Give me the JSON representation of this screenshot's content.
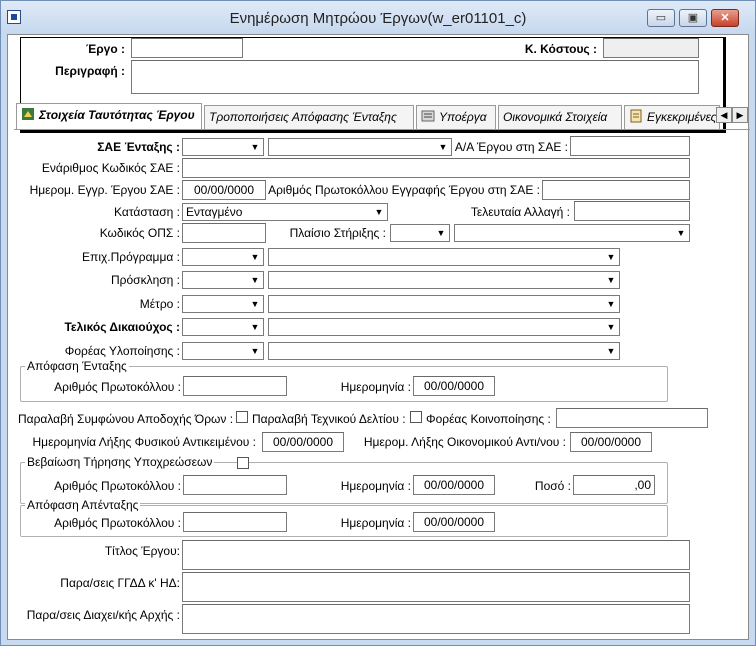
{
  "window": {
    "title": "Ενημέρωση Μητρώου Έργων(w_er01101_c)",
    "minimize_label": "▭",
    "maximize_label": "▣",
    "close_label": "✕"
  },
  "header": {
    "project_label": "Έργο :",
    "project_value": "",
    "cost_code_label": "Κ. Κόστους :",
    "cost_code_value": "",
    "description_label": "Περιγραφή :",
    "description_value": ""
  },
  "tabs": [
    {
      "label": "Στοιχεία Ταυτότητας Έργου",
      "icon": "identity-icon",
      "active": true
    },
    {
      "label": "Τροποποιήσεις Απόφασης Ένταξης",
      "icon": "",
      "active": false
    },
    {
      "label": "Υποέργα",
      "icon": "subprojects-icon",
      "active": false
    },
    {
      "label": "Οικονομικά Στοιχεία",
      "icon": "",
      "active": false
    },
    {
      "label": "Εγκεκριμένες Π",
      "icon": "approved-icon",
      "active": false
    }
  ],
  "tab_scroll": {
    "left": "◀",
    "right": "▶"
  },
  "form": {
    "sae_label": "ΣΑΕ Ένταξης :",
    "sae_code": "",
    "sae_desc": "",
    "aa_label": "Α/Α Έργου στη ΣΑΕ :",
    "aa_value": "",
    "enarithmos_label": "Ενάριθμος Κωδικός ΣΑΕ :",
    "enarithmos_value": "",
    "reg_date_label": "Ημερομ. Εγγρ. Έργου ΣΑΕ :",
    "reg_date_value": "00/00/0000",
    "protocol_reg_label": "Αριθμός Πρωτοκόλλου Εγγραφής Έργου στη ΣΑΕ :",
    "protocol_reg_value": "",
    "status_label": "Κατάσταση :",
    "status_value": "Ενταγμένο",
    "last_change_label": "Τελευταία Αλλαγή :",
    "last_change_value": "",
    "ops_label": "Κωδικός ΟΠΣ :",
    "ops_value": "",
    "support_label": "Πλαίσιο Στήριξης :",
    "support_code": "",
    "support_desc": "",
    "program_label": "Επιχ.Πρόγραμμα :",
    "invitation_label": "Πρόσκληση :",
    "measure_label": "Μέτρο :",
    "beneficiary_label": "Τελικός Δικαιούχος :",
    "implementer_label": "Φορέας Υλοποίησης :"
  },
  "inclusion_decision": {
    "group_label": "Απόφαση Ένταξης",
    "protocol_label": "Αριθμός Πρωτοκόλλου :",
    "protocol_value": "",
    "date_label": "Ημερομηνία :",
    "date_value": "00/00/0000"
  },
  "receipts": {
    "terms_label": "Παραλαβή Συμφώνου Αποδοχής Όρων :",
    "tech_label": "Παραλαβή Τεχνικού Δελτίου :",
    "notify_label": "Φορέας Κοινοποίησης :",
    "notify_value": ""
  },
  "end_dates": {
    "physical_label": "Ημερομηνία Λήξης Φυσικού Αντικειμένου :",
    "physical_value": "00/00/0000",
    "financial_label": "Ημερομ. Λήξης Οικονομικού Αντι/νου :",
    "financial_value": "00/00/0000"
  },
  "compliance": {
    "group_label": "Βεβαίωση Τήρησης Υποχρεώσεων",
    "protocol_label": "Αριθμός Πρωτοκόλλου :",
    "protocol_value": "",
    "date_label": "Ημερομηνία :",
    "date_value": "00/00/0000",
    "amount_label": "Ποσό :",
    "amount_value": ",00"
  },
  "exclusion_decision": {
    "group_label": "Απόφαση Απένταξης",
    "protocol_label": "Αριθμός Πρωτοκόλλου :",
    "protocol_value": "",
    "date_label": "Ημερομηνία :",
    "date_value": "00/00/0000"
  },
  "notes": {
    "title_label": "Τίτλος Έργου:",
    "ggdd_label": "Παρα/σεις ΓΓΔΔ κ' ΗΔ:",
    "authority_label": "Παρα/σεις Διαχει/κής Αρχής :"
  },
  "colors": {
    "titlebar": "#c6d8ef",
    "window_border": "#6f8fb6",
    "close": "#c7412a"
  }
}
